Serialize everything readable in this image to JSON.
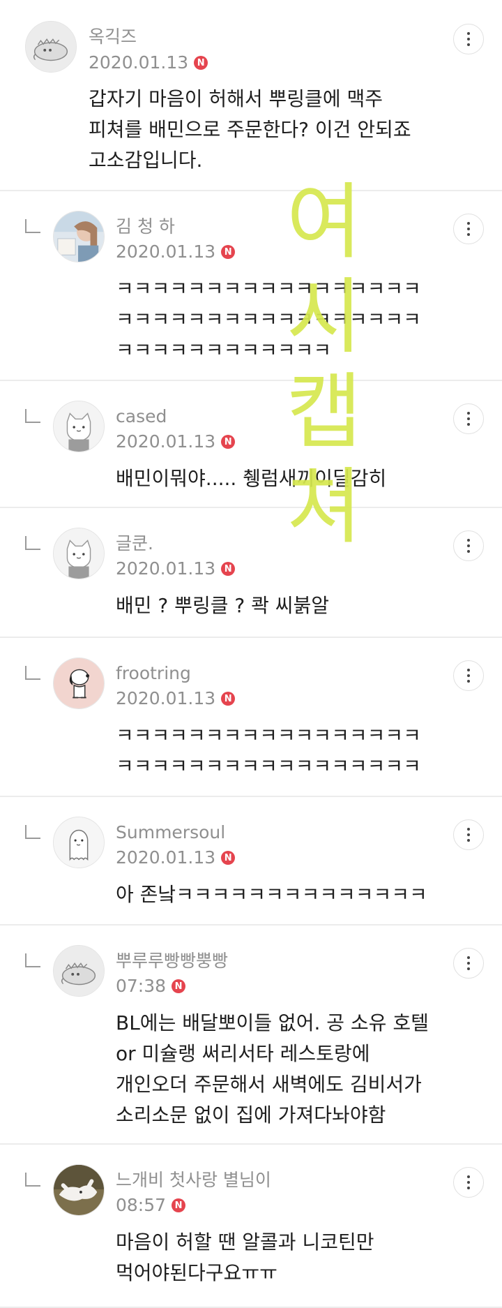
{
  "comments": [
    {
      "author": "옥긱즈",
      "date": "2020.01.13",
      "badge": "N",
      "is_reply": false,
      "avatar": "dinosaur-avatar",
      "body_lines": [
        "갑자기 마음이 허해서 뿌링클에 맥주",
        "피쳐를 배민으로 주문한다? 이건 안되죠",
        "고소감입니다."
      ]
    },
    {
      "author": "김 청 하",
      "date": "2020.01.13",
      "badge": "N",
      "is_reply": true,
      "avatar": "photo-avatar",
      "body_lines": [
        "ㅋㅋㅋㅋㅋㅋㅋㅋㅋㅋㅋㅋㅋㅋㅋㅋㅋ",
        "ㅋㅋㅋㅋㅋㅋㅋㅋㅋㅋㅋㅋㅋㅋㅋㅋㅋ",
        "ㅋㅋㅋㅋㅋㅋㅋㅋㅋㅋㅋㅋ"
      ]
    },
    {
      "author": "cased",
      "date": "2020.01.13",
      "badge": "N",
      "is_reply": true,
      "avatar": "cat-avatar",
      "body_lines": [
        "배민이뭐야..... 췡럼새끼이딜감히"
      ]
    },
    {
      "author": "글쿤.",
      "date": "2020.01.13",
      "badge": "N",
      "is_reply": true,
      "avatar": "cat-avatar",
      "body_lines": [
        "배민 ? 뿌링클 ? 콱 씨붉알"
      ]
    },
    {
      "author": "frootring",
      "date": "2020.01.13",
      "badge": "N",
      "is_reply": true,
      "avatar": "snoopy-avatar",
      "body_lines": [
        "ㅋㅋㅋㅋㅋㅋㅋㅋㅋㅋㅋㅋㅋㅋㅋㅋㅋ",
        "ㅋㅋㅋㅋㅋㅋㅋㅋㅋㅋㅋㅋㅋㅋㅋㅋㅋ"
      ]
    },
    {
      "author": "Summersoul",
      "date": "2020.01.13",
      "badge": "N",
      "is_reply": true,
      "avatar": "ghost-avatar",
      "body_lines": [
        "아 존낰ㅋㅋㅋㅋㅋㅋㅋㅋㅋㅋㅋㅋㅋㅋ"
      ]
    },
    {
      "author": "뿌루루빵빵뿡빵",
      "date": "07:38",
      "badge": "N",
      "is_reply": true,
      "avatar": "dinosaur-avatar",
      "body_lines": [
        "BL에는 배달뽀이들 없어. 공 소유 호텔",
        "or 미슐랭 써리서타 레스토랑에",
        "개인오더 주문해서 새벽에도 김비서가",
        "소리소문 없이 집에 가져다놔야함"
      ]
    },
    {
      "author": "느개비 첫사랑 별님이",
      "date": "08:57",
      "badge": "N",
      "is_reply": true,
      "avatar": "dog-photo-avatar",
      "body_lines": [
        "마음이 허할 땐 알콜과 니코틴만",
        "먹어야된다구요ㅠㅠ"
      ]
    }
  ],
  "watermark": {
    "chars": [
      "여",
      "시",
      "캡",
      "쳐"
    ],
    "color": "#d6e84f"
  },
  "icons": {
    "more": "more-vertical-icon",
    "reply": "reply-arrow-icon",
    "badge": "new-badge-icon"
  }
}
